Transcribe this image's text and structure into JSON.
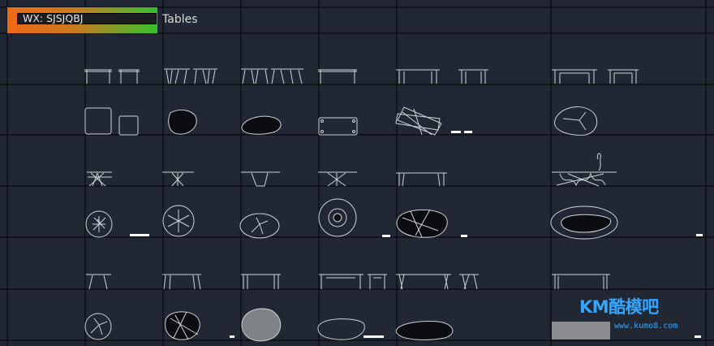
{
  "badge": {
    "text": "WX: SJSJQBJ"
  },
  "sheet": {
    "title": "Tables"
  },
  "watermark": {
    "logo": "KM酷模吧",
    "url": "www.kumo8.com"
  },
  "colors": {
    "background": "#222833",
    "gridline": "#0b0e13",
    "linework": "#cfd3d8",
    "badge_gradient_start": "#f06a17",
    "badge_gradient_end": "#34c02e",
    "watermark": "#34a6ff"
  }
}
